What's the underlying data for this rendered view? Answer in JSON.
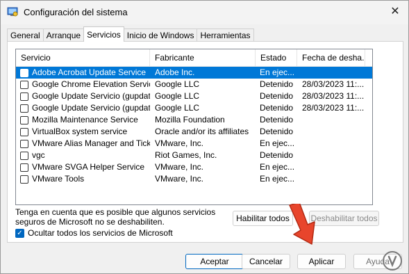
{
  "window": {
    "title": "Configuración del sistema",
    "close_glyph": "✕"
  },
  "tabs": [
    {
      "label": "General"
    },
    {
      "label": "Arranque"
    },
    {
      "label": "Servicios"
    },
    {
      "label": "Inicio de Windows"
    },
    {
      "label": "Herramientas"
    }
  ],
  "active_tab": "Servicios",
  "list": {
    "columns": [
      "Servicio",
      "Fabricante",
      "Estado",
      "Fecha de desha..."
    ],
    "rows": [
      {
        "name": "Adobe Acrobat Update Service",
        "maker": "Adobe Inc.",
        "state": "En ejec...",
        "date": "",
        "selected": true
      },
      {
        "name": "Google Chrome Elevation Servic...",
        "maker": "Google LLC",
        "state": "Detenido",
        "date": "28/03/2023 11:..."
      },
      {
        "name": "Google Update Servicio (gupdate)",
        "maker": "Google LLC",
        "state": "Detenido",
        "date": "28/03/2023 11:..."
      },
      {
        "name": "Google Update Servicio (gupdat...",
        "maker": "Google LLC",
        "state": "Detenido",
        "date": "28/03/2023 11:..."
      },
      {
        "name": "Mozilla Maintenance Service",
        "maker": "Mozilla Foundation",
        "state": "Detenido",
        "date": ""
      },
      {
        "name": "VirtualBox system service",
        "maker": "Oracle and/or its affiliates",
        "state": "Detenido",
        "date": ""
      },
      {
        "name": "VMware Alias Manager and Ticke...",
        "maker": "VMware, Inc.",
        "state": "En ejec...",
        "date": ""
      },
      {
        "name": "vgc",
        "maker": "Riot Games, Inc.",
        "state": "Detenido",
        "date": ""
      },
      {
        "name": "VMware SVGA Helper Service",
        "maker": "VMware, Inc.",
        "state": "En ejec...",
        "date": ""
      },
      {
        "name": "VMware Tools",
        "maker": "VMware, Inc.",
        "state": "En ejec...",
        "date": ""
      }
    ]
  },
  "note": "Tenga en cuenta que es posible que algunos servicios seguros de Microsoft no se deshabiliten.",
  "hide_ms_label": "Ocultar todos los servicios de Microsoft",
  "buttons": {
    "habilitar": "Habilitar todos",
    "deshabilitar": "Deshabilitar todos",
    "aceptar": "Aceptar",
    "cancelar": "Cancelar",
    "aplicar": "Aplicar",
    "ayuda": "Ayuda"
  },
  "colors": {
    "selection": "#0078d7",
    "arrow": "#e8452c",
    "checkbox_checked": "#0067c0"
  }
}
